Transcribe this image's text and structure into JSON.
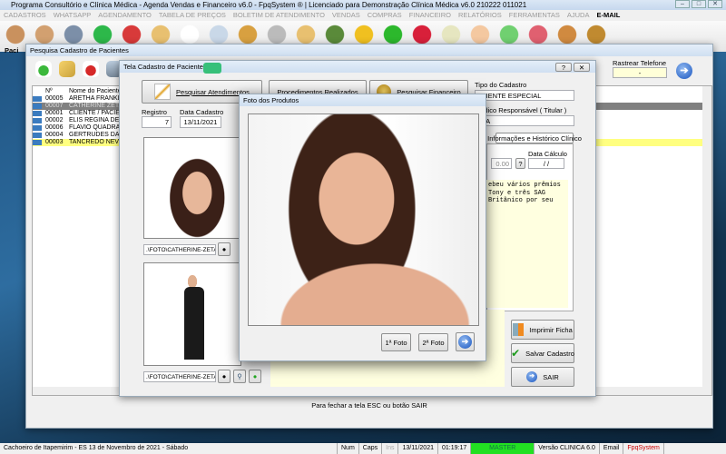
{
  "app": {
    "title": "Programa Consultório e Clínica Médica - Agenda Vendas e Financeiro v6.0 - FpqSystem ® | Licenciado para  Demonstração Clínica Médica v6.0 210222 011021"
  },
  "menu": [
    "CADASTROS",
    "WHATSAPP",
    "AGENDAMENTO",
    "TABELA DE PREÇOS",
    "BOLETIM DE ATENDIMENTO",
    "VENDAS",
    "COMPRAS",
    "FINANCEIRO",
    "RELATÓRIOS",
    "FERRAMENTAS",
    "AJUDA"
  ],
  "menu_email": "E-MAIL",
  "search_window": {
    "title": "Pesquisa Cadastro de Pacientes",
    "tab_short": "Paci",
    "col_num": "Nº",
    "col_name": "Nome do Paciente",
    "rows": [
      {
        "num": "00005",
        "name": "ARETHA FRANKLIN"
      },
      {
        "num": "00007",
        "name": "CATHERINE ZETA JONES"
      },
      {
        "num": "00001",
        "name": "CLIENTE / PACIENTES"
      },
      {
        "num": "00002",
        "name": "ELIS REGINA DE ALMEIDA"
      },
      {
        "num": "00006",
        "name": "FLAVIO QUADRADO"
      },
      {
        "num": "00004",
        "name": "GERTRUDES DA CONCEIÇÃO"
      },
      {
        "num": "00003",
        "name": "TANCREDO NEVES"
      }
    ],
    "rastrear_label": "Rastrear Telefone",
    "rastrear_value": "-",
    "footer": "Para fechar a tela ESC ou botão SAIR"
  },
  "cadastro": {
    "title": "Tela Cadastro de Pacientes",
    "btn_atend": "Pesquisar Atendimentos",
    "btn_proc": "Procedimentos Realizados",
    "btn_fin": "Pesquisar Financeiro",
    "tipo_label": "Tipo do Cadastro",
    "tipo_value": "CLIENTE ESPECIAL",
    "resp_label": "Médico Responsável ( Titular )",
    "resp_value": "ELA",
    "registro_label": "Registro",
    "registro_value": "7",
    "data_label": "Data Cadastro",
    "data_value": "13/11/2021",
    "foto1_path": ".\\FOTO\\CATHERINE-ZETA-",
    "foto2_path": ".\\FOTO\\CATHERINE-ZETA-",
    "tab_info": "Informações e Histórico Clínico",
    "valor": "0.00",
    "help": "?",
    "data_calc_label": "Data Cálculo",
    "data_calc_value": " / /",
    "historico": "ebeu vários prêmios\nTony e três SAG\nBritânico por seu",
    "btn_imprimir": "Imprimir Ficha",
    "btn_salvar": "Salvar Cadastro",
    "btn_sair": "SAIR"
  },
  "foto_dialog": {
    "title": "Foto dos Produtos",
    "btn1": "1ª Foto",
    "btn2": "2ª Foto"
  },
  "statusbar": {
    "location": "Cachoeiro de Itapemirim - ES 13 de Novembro de 2021 - Sábado",
    "num": "Num",
    "caps": "Caps",
    "ins": "Ins",
    "date": "13/11/2021",
    "time": "01:19:17",
    "user": "MASTER",
    "version": "Versão CLINICA 6.0",
    "email": "Email",
    "brand": "FpqSystem"
  },
  "colors": {
    "user_bg": "#22e022",
    "highlight_row": "#ffff80",
    "selected_row": "#808080",
    "note_bg": "#ffffe0"
  }
}
